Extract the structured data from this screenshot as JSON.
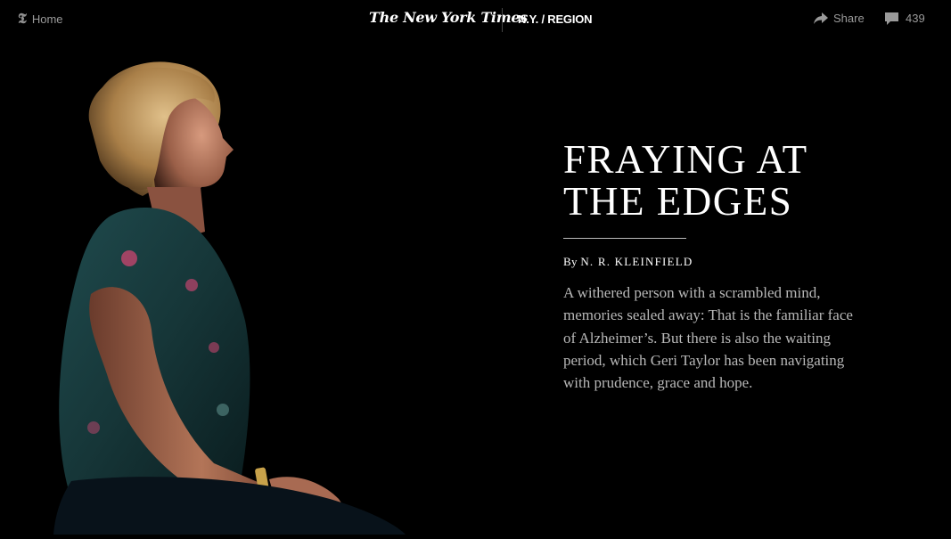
{
  "nav": {
    "home_label": "Home",
    "masthead": "The New York Times",
    "section": "N.Y. / REGION",
    "share_label": "Share",
    "comment_count": "439"
  },
  "article": {
    "headline_line1": "FRAYING AT",
    "headline_line2": "THE EDGES",
    "byline_prefix": "By",
    "author": "N. R. KLEINFIELD",
    "summary": "A withered person with a scrambled mind, memories sealed away: That is the familiar face of Alzheimer’s. But there is also the waiting period, which Geri Taylor has been navigating with prudence, grace and hope."
  },
  "icons": {
    "home": "nyt-t-logo-icon",
    "share": "share-arrow-icon",
    "comments": "comment-bubble-icon"
  },
  "colors": {
    "background": "#000000",
    "nav_text": "#9a9a9a",
    "summary_text": "#b8b8b8"
  }
}
